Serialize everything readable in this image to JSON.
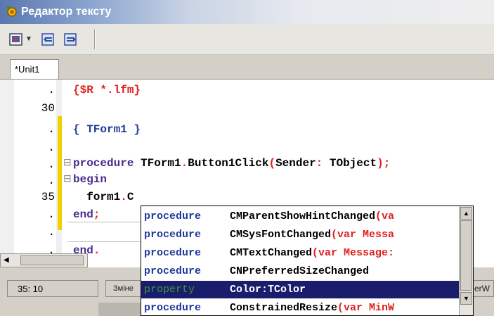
{
  "window": {
    "title": "Редактор тексту"
  },
  "tabs": [
    {
      "label": "*Unit1"
    }
  ],
  "editor": {
    "lines": [
      {
        "num": ".",
        "text_parts": [
          {
            "t": "{$R *.lfm}",
            "c": "red"
          }
        ]
      },
      {
        "num": "30",
        "text_parts": []
      },
      {
        "num": ".",
        "text_parts": [
          {
            "t": "{ TForm1 }",
            "c": "blue"
          }
        ]
      },
      {
        "num": ".",
        "text_parts": []
      },
      {
        "num": ".",
        "text_parts": [
          {
            "t": "procedure ",
            "c": "purple"
          },
          {
            "t": "TForm1",
            "c": "black"
          },
          {
            "t": ".",
            "c": "red"
          },
          {
            "t": "Button1Click",
            "c": "black"
          },
          {
            "t": "(",
            "c": "red"
          },
          {
            "t": "Sender",
            "c": "black"
          },
          {
            "t": ": ",
            "c": "red"
          },
          {
            "t": "TObject",
            "c": "black"
          },
          {
            "t": ");",
            "c": "red"
          }
        ]
      },
      {
        "num": ".",
        "text_parts": [
          {
            "t": "begin",
            "c": "purple"
          }
        ]
      },
      {
        "num": "35",
        "text_parts": [
          {
            "t": "  form1",
            "c": "black"
          },
          {
            "t": ".",
            "c": "red"
          },
          {
            "t": "C",
            "c": "black"
          }
        ]
      },
      {
        "num": ".",
        "text_parts": [
          {
            "t": "end",
            "c": "purple"
          },
          {
            "t": ";",
            "c": "red"
          }
        ]
      },
      {
        "num": ".",
        "text_parts": []
      },
      {
        "num": ".",
        "text_parts": [
          {
            "t": "end",
            "c": "purple"
          },
          {
            "t": ".",
            "c": "red"
          }
        ]
      }
    ]
  },
  "autocomplete": {
    "items": [
      {
        "kind": "procedure",
        "name": "CMParentShowHintChanged",
        "args": "(va"
      },
      {
        "kind": "procedure",
        "name": "CMSysFontChanged",
        "args": "(var Messa"
      },
      {
        "kind": "procedure",
        "name": "CMTextChanged",
        "args": "(var Message:"
      },
      {
        "kind": "procedure",
        "name": "CNPreferredSizeChanged",
        "args": ""
      },
      {
        "kind": "property",
        "name": "Color:TColor",
        "args": "",
        "selected": true
      },
      {
        "kind": "procedure",
        "name": "ConstrainedResize",
        "args": "(var MinW"
      }
    ]
  },
  "statusbar": {
    "position": "35: 10",
    "modified": "Зміне",
    "right_fragment": "erW"
  },
  "icons": {
    "title": "app-gear-icon",
    "toolbar": [
      "open-file-icon",
      "dropdown-arrow-icon",
      "save-icon",
      "save-as-icon"
    ]
  }
}
